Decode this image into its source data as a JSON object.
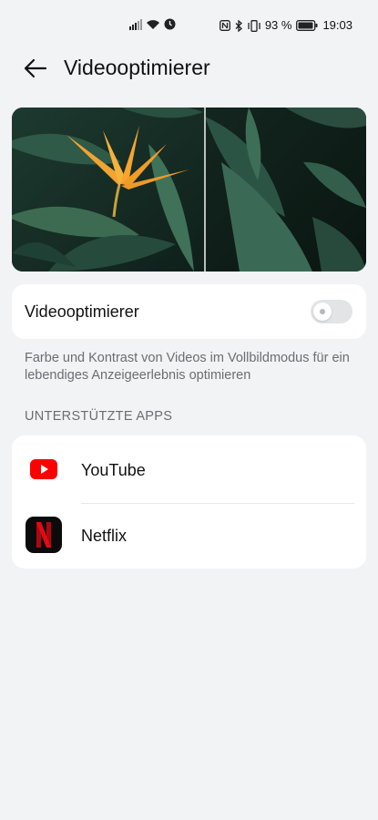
{
  "status_bar": {
    "battery_text": "93 %",
    "time": "19:03",
    "icons": [
      "signal-icon",
      "wifi-icon",
      "alarm-icon",
      "nfc-icon",
      "bluetooth-icon",
      "vibrate-icon",
      "battery-icon"
    ]
  },
  "header": {
    "title": "Videooptimierer",
    "back_icon": "back-arrow-icon"
  },
  "preview": {
    "description_icon": "preview-image"
  },
  "toggle": {
    "label": "Videooptimierer",
    "state": "off"
  },
  "description": "Farbe und Kontrast von Videos im Vollbildmodus für ein lebendiges Anzeigeerlebnis optimieren",
  "supported_apps": {
    "header": "UNTERSTÜTZTE APPS",
    "items": [
      {
        "label": "YouTube",
        "icon": "youtube-icon"
      },
      {
        "label": "Netflix",
        "icon": "netflix-icon"
      }
    ]
  },
  "colors": {
    "background": "#f1f3f5",
    "card": "#ffffff",
    "secondary_text": "#6b6d72",
    "youtube_red": "#ff0000",
    "netflix_red": "#e50914"
  }
}
